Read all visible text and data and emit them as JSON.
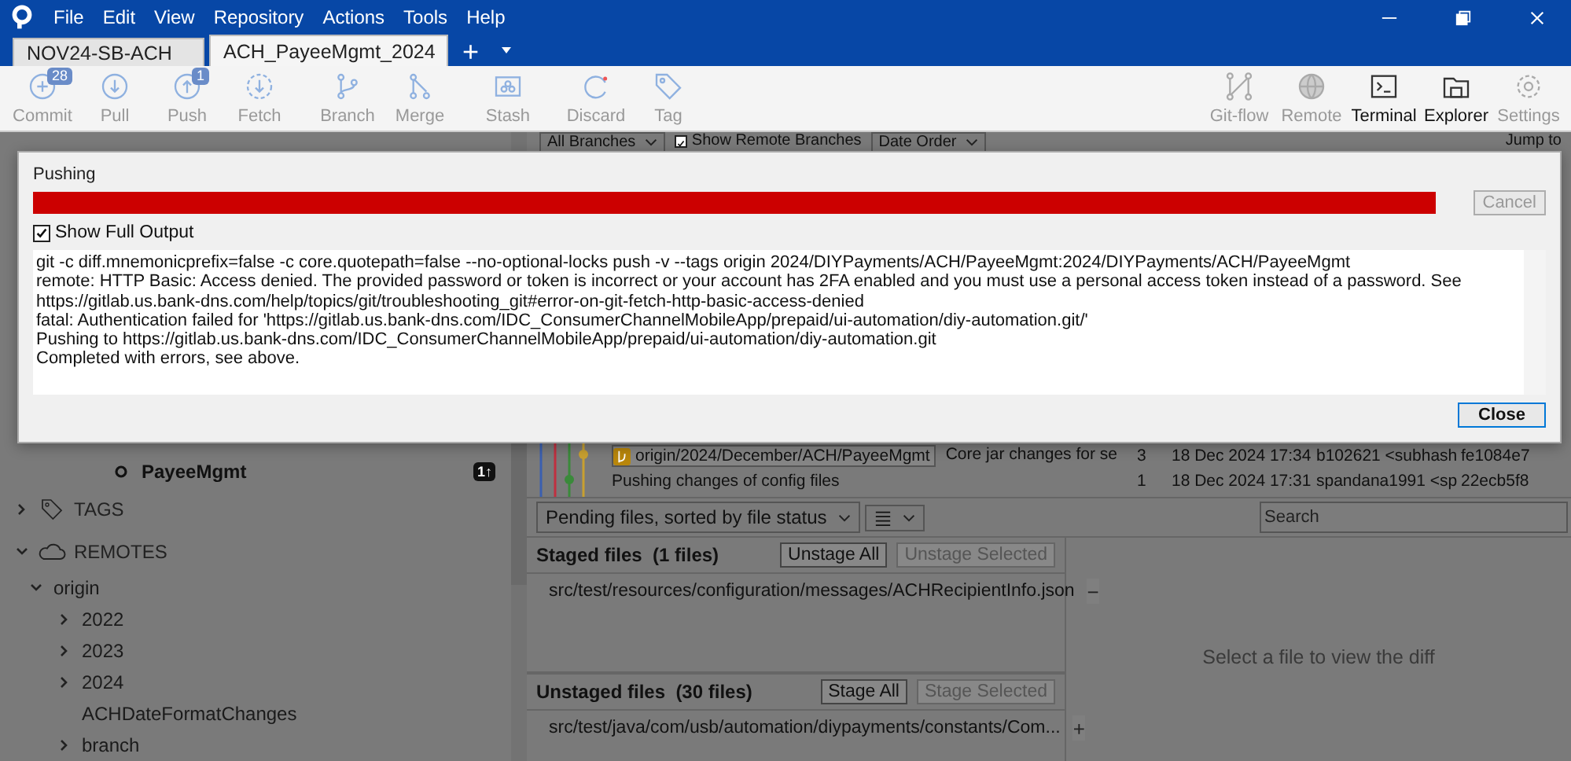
{
  "menu": [
    "File",
    "Edit",
    "View",
    "Repository",
    "Actions",
    "Tools",
    "Help"
  ],
  "tabs": [
    {
      "label": "NOV24-SB-ACH",
      "selected": false
    },
    {
      "label": "ACH_PayeeMgmt_2024",
      "selected": true
    }
  ],
  "new_tab": "+",
  "toolbar": [
    {
      "label": "Commit",
      "kind": "plus",
      "badge": "28",
      "disabled": true
    },
    {
      "label": "Pull",
      "kind": "down",
      "disabled": true
    },
    {
      "label": "Push",
      "kind": "up",
      "badge": "1",
      "disabled": true
    },
    {
      "label": "Fetch",
      "kind": "fetch",
      "disabled": true
    },
    {
      "label": "Branch",
      "kind": "branch",
      "disabled": true
    },
    {
      "label": "Merge",
      "kind": "merge",
      "disabled": true
    },
    {
      "label": "Stash",
      "kind": "stash",
      "disabled": true
    },
    {
      "label": "Discard",
      "kind": "discard",
      "disabled": true
    },
    {
      "label": "Tag",
      "kind": "tag",
      "disabled": true
    }
  ],
  "toolbar_right": [
    {
      "label": "Git-flow",
      "kind": "flow",
      "disabled": true
    },
    {
      "label": "Remote",
      "kind": "globe",
      "disabled": true
    },
    {
      "label": "Terminal",
      "kind": "terminal",
      "disabled": false
    },
    {
      "label": "Explorer",
      "kind": "folder",
      "disabled": false
    },
    {
      "label": "Settings",
      "kind": "gear",
      "disabled": true
    }
  ],
  "filters": {
    "branches": "All Branches",
    "show_remote": {
      "label": "Show Remote Branches",
      "checked": true
    },
    "order": "Date Order",
    "jump": "Jump to"
  },
  "sidebar": {
    "current": {
      "label": "PayeeMgmt",
      "badge": "1↑"
    },
    "sections": [
      {
        "label": "TAGS",
        "kind": "tag",
        "expanded": false
      },
      {
        "label": "REMOTES",
        "kind": "cloud",
        "expanded": true,
        "children": [
          {
            "label": "origin",
            "expanded": true,
            "children": [
              {
                "label": "2022",
                "expanded": false
              },
              {
                "label": "2023",
                "expanded": false
              },
              {
                "label": "2024",
                "expanded": false
              },
              {
                "label": "ACHDateFormatChanges"
              },
              {
                "label": "branch",
                "expanded": false
              }
            ]
          }
        ]
      }
    ]
  },
  "commits": [
    {
      "tag": "origin/2024/December/ACH/PayeeMgmt",
      "message": "Core jar changes for se",
      "count": "3",
      "date": "18 Dec 2024 17:34",
      "author": "b102621 <subhash",
      "hash": "fe1084e7"
    },
    {
      "message": "Pushing changes of config files",
      "count": "1",
      "date": "18 Dec 2024 17:31",
      "author": "spandana1991 <sp",
      "hash": "22ecb5f8"
    }
  ],
  "pending": {
    "filter": "Pending files, sorted by file status",
    "search_placeholder": "Search"
  },
  "staged": {
    "title": "Staged files",
    "count": "(1 files)",
    "buttons": [
      {
        "label": "Unstage All",
        "disabled": false
      },
      {
        "label": "Unstage Selected",
        "disabled": true
      }
    ],
    "files": [
      {
        "path": "src/test/resources/configuration/messages/ACHRecipientInfo.json",
        "kind": "added",
        "action": "−"
      }
    ]
  },
  "unstaged": {
    "title": "Unstaged files",
    "count": "(30 files)",
    "buttons": [
      {
        "label": "Stage All",
        "disabled": false
      },
      {
        "label": "Stage Selected",
        "disabled": true
      }
    ],
    "files": [
      {
        "path": "src/test/java/com/usb/automation/diypayments/constants/Com...",
        "kind": "modified",
        "action": "+"
      }
    ]
  },
  "diff_hint": "Select a file to view the diff",
  "dialog": {
    "title": "Pushing",
    "level": 1,
    "cancel": {
      "label": "Cancel",
      "disabled": true
    },
    "show_full": {
      "label": "Show Full Output",
      "checked": true
    },
    "output": [
      "git -c diff.mnemonicprefix=false -c core.quotepath=false --no-optional-locks push -v --tags origin 2024/DIYPayments/ACH/PayeeMgmt:2024/DIYPayments/ACH/PayeeMgmt",
      "remote: HTTP Basic: Access denied. The provided password or token is incorrect or your account has 2FA enabled and you must use a personal access token instead of a password. See https://gitlab.us.bank-dns.com/help/topics/git/troubleshooting_git#error-on-git-fetch-http-basic-access-denied",
      "fatal: Authentication failed for 'https://gitlab.us.bank-dns.com/IDC_ConsumerChannelMobileApp/prepaid/ui-automation/diy-automation.git/'",
      "Pushing to https://gitlab.us.bank-dns.com/IDC_ConsumerChannelMobileApp/prepaid/ui-automation/diy-automation.git",
      "Completed with errors, see above."
    ],
    "close": "Close"
  }
}
